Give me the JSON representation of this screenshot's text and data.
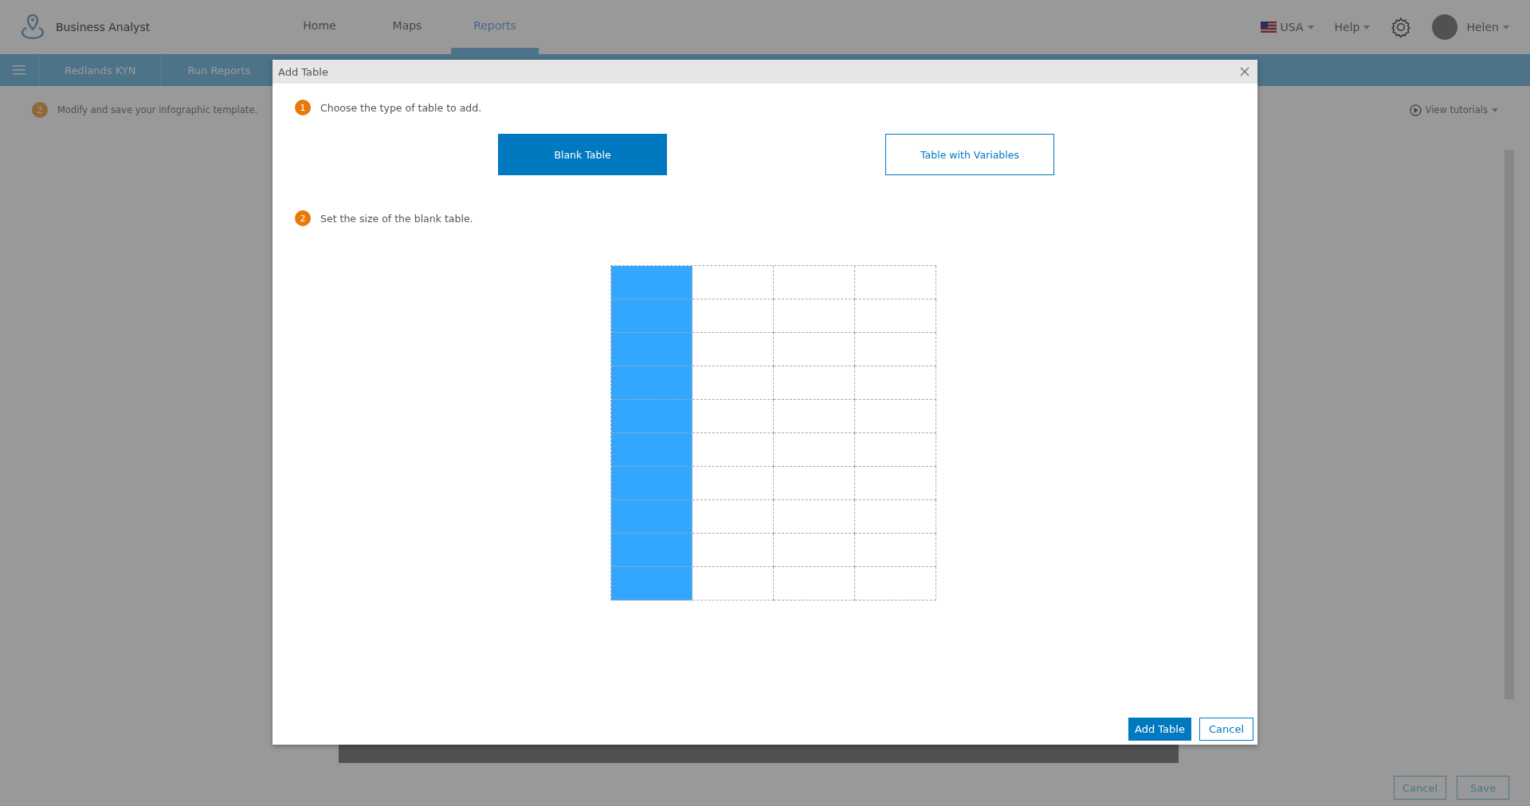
{
  "app": {
    "name": "Business Analyst"
  },
  "nav": [
    {
      "label": "Home",
      "selected": false
    },
    {
      "label": "Maps",
      "selected": false
    },
    {
      "label": "Reports",
      "selected": true
    }
  ],
  "header_right": {
    "country": "USA",
    "help": "Help",
    "user": "Helen"
  },
  "subnav": [
    {
      "label": "Redlands KYN"
    },
    {
      "label": "Run Reports"
    }
  ],
  "step_hint": {
    "number": "2",
    "text": "Modify and save your infographic template."
  },
  "view_tutorials": "View tutorials",
  "page_buttons": [
    "Cancel",
    "Save"
  ],
  "dialog": {
    "title": "Add Table",
    "steps": [
      {
        "number": "1",
        "text": "Choose the type of table to add."
      },
      {
        "number": "2",
        "text": "Set the size of the blank table."
      }
    ],
    "table_types": [
      {
        "label": "Blank Table",
        "selected": true
      },
      {
        "label": "Table with Variables",
        "selected": false
      }
    ],
    "size_grid": {
      "rows": [
        {
          "cells": [
            {
              "highlighted": true
            },
            {
              "highlighted": false
            },
            {
              "highlighted": false
            },
            {
              "highlighted": false
            }
          ]
        },
        {
          "cells": [
            {
              "highlighted": true
            },
            {
              "highlighted": false
            },
            {
              "highlighted": false
            },
            {
              "highlighted": false
            }
          ]
        },
        {
          "cells": [
            {
              "highlighted": true
            },
            {
              "highlighted": false
            },
            {
              "highlighted": false
            },
            {
              "highlighted": false
            }
          ]
        },
        {
          "cells": [
            {
              "highlighted": true
            },
            {
              "highlighted": false
            },
            {
              "highlighted": false
            },
            {
              "highlighted": false
            }
          ]
        },
        {
          "cells": [
            {
              "highlighted": true
            },
            {
              "highlighted": false
            },
            {
              "highlighted": false
            },
            {
              "highlighted": false
            }
          ]
        },
        {
          "cells": [
            {
              "highlighted": true
            },
            {
              "highlighted": false
            },
            {
              "highlighted": false
            },
            {
              "highlighted": false
            }
          ]
        },
        {
          "cells": [
            {
              "highlighted": true
            },
            {
              "highlighted": false
            },
            {
              "highlighted": false
            },
            {
              "highlighted": false
            }
          ]
        },
        {
          "cells": [
            {
              "highlighted": true
            },
            {
              "highlighted": false
            },
            {
              "highlighted": false
            },
            {
              "highlighted": false
            }
          ]
        },
        {
          "cells": [
            {
              "highlighted": true
            },
            {
              "highlighted": false
            },
            {
              "highlighted": false
            },
            {
              "highlighted": false
            }
          ]
        },
        {
          "cells": [
            {
              "highlighted": true
            },
            {
              "highlighted": false
            },
            {
              "highlighted": false
            },
            {
              "highlighted": false
            }
          ]
        }
      ]
    },
    "buttons": [
      {
        "label": "Add Table",
        "kind": "primary"
      },
      {
        "label": "Cancel",
        "kind": "secondary"
      }
    ]
  }
}
